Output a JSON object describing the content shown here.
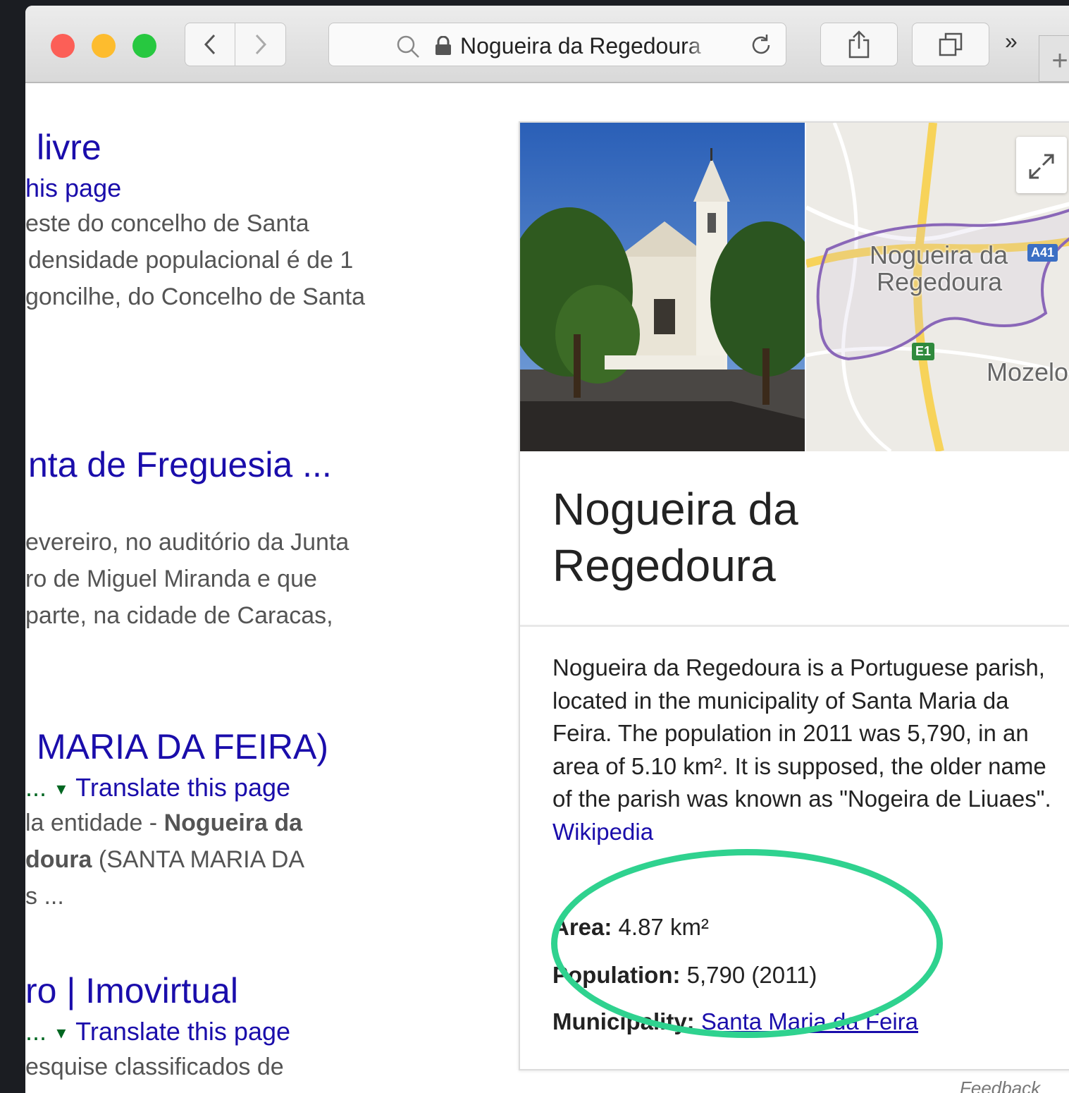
{
  "browser": {
    "url_text": "Nogueira da Regedoura",
    "more_label": "»",
    "new_tab_label": "+"
  },
  "results": [
    {
      "title": "livre",
      "link": "his page",
      "snippets": [
        "este do concelho de Santa",
        "densidade populacional é de 1",
        "goncilhe, do Concelho de Santa"
      ]
    },
    {
      "title": "nta de Freguesia ...",
      "snippets": [
        "evereiro, no auditório da Junta",
        "ro de Miguel Miranda e que",
        "parte, na cidade de Caracas,"
      ]
    },
    {
      "title": "MARIA DA FEIRA)",
      "link_prefix": "...",
      "link": "Translate this page",
      "snippets": [
        "la entidade - ",
        "Nogueira da",
        "doura",
        " (SANTA MARIA DA",
        "s ..."
      ]
    },
    {
      "title": "ro | Imovirtual",
      "link_prefix": "...",
      "link": "Translate this page",
      "snippets": [
        "esquise classificados de"
      ]
    }
  ],
  "knowledge_panel": {
    "title_line1": "Nogueira da",
    "title_line2": "Regedoura",
    "map_label_line1": "Nogueira da",
    "map_label_line2": "Regedoura",
    "map_label_other": "Mozelo",
    "shield_a41": "A41",
    "shield_e1": "E1",
    "description": "Nogueira da Regedoura is a Portuguese parish, located in the municipality of Santa Maria da Feira. The population in 2011 was 5,790, in an area of 5.10 km². It is supposed, the older name of the parish was known as \"Nogeira de Liuaes\".",
    "source_link": "Wikipedia",
    "facts": {
      "area_label": "Area:",
      "area_value": "4.87 km²",
      "population_label": "Population:",
      "population_value": "5,790 (2011)",
      "municipality_label": "Municipality:",
      "municipality_value": "Santa Maria da Feira"
    },
    "feedback": "Feedback"
  },
  "colors": {
    "link": "#1a0dab",
    "highlight": "#2fd28f",
    "map_road": "#f7d35a",
    "boundary": "#8a67b8"
  }
}
